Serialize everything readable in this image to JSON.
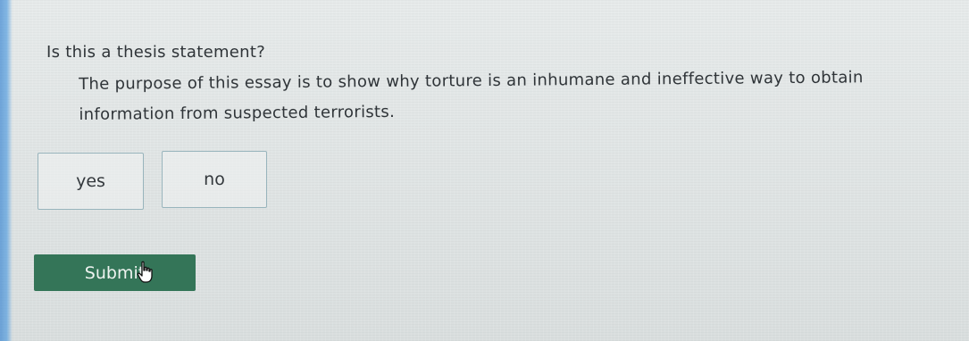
{
  "question": {
    "prompt": "Is this a thesis statement?",
    "statement": "The purpose of this essay is to show why torture is an inhumane and ineffective way to obtain information from suspected terrorists."
  },
  "choices": [
    {
      "label": "yes"
    },
    {
      "label": "no"
    }
  ],
  "submit": {
    "label": "Submit"
  },
  "cursor": {
    "icon": "hand-pointer-icon"
  },
  "colors": {
    "submit_bg": "#347558",
    "choice_border": "#98b4bc",
    "background": "#dfe3e3"
  }
}
